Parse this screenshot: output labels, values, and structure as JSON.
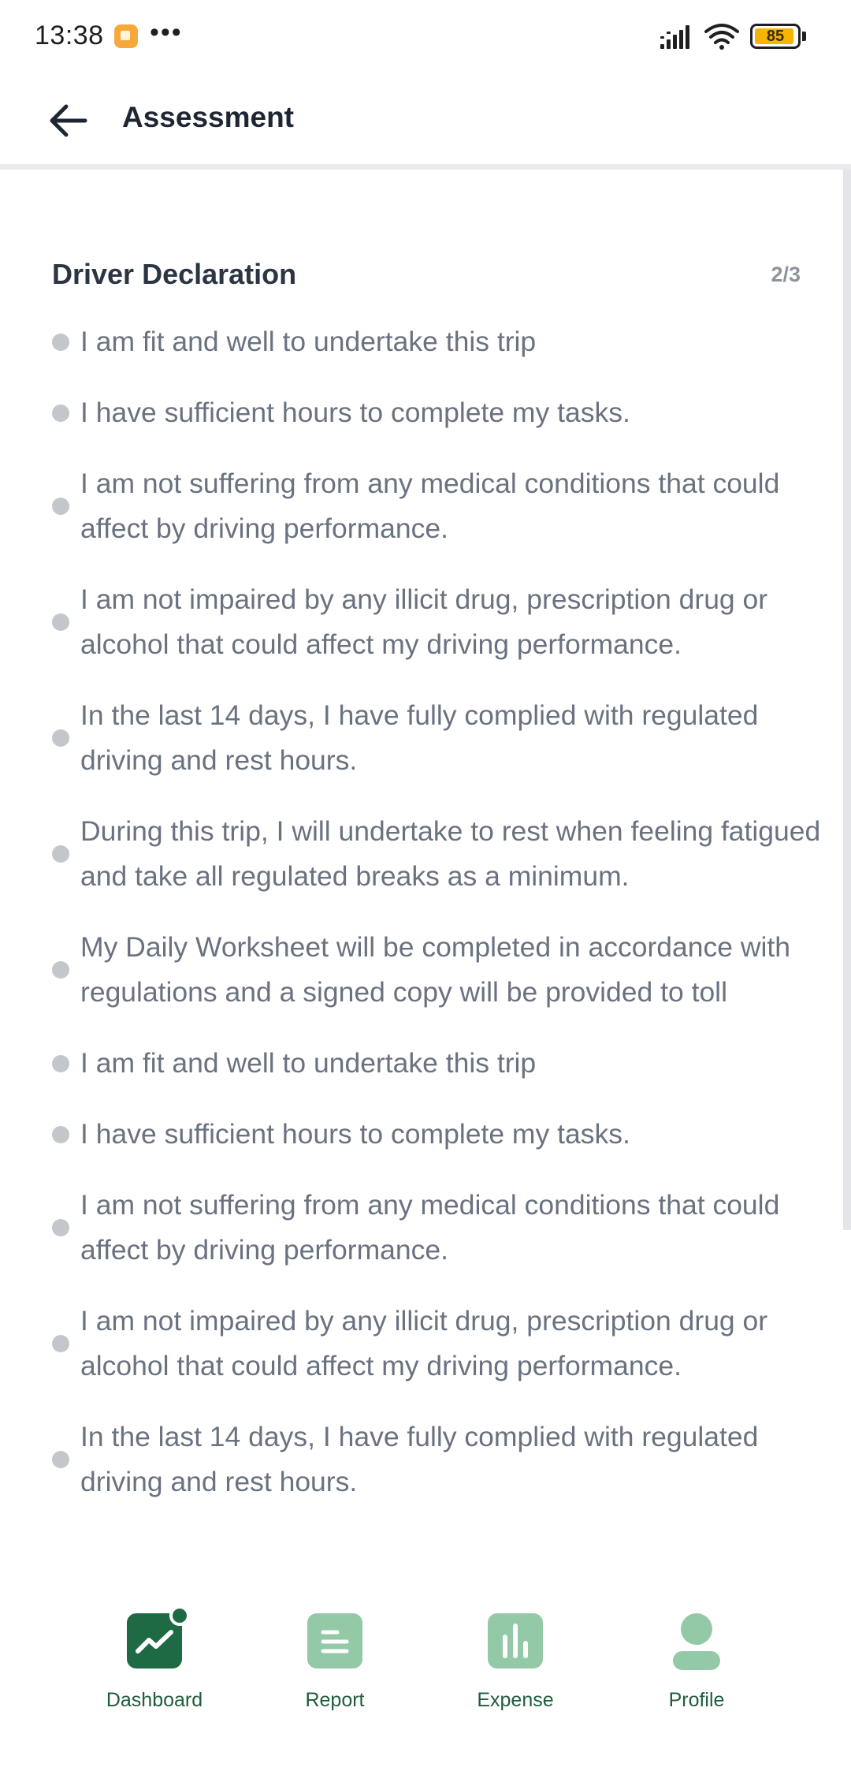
{
  "status_bar": {
    "time": "13:38",
    "more": "•••",
    "battery": "85"
  },
  "header": {
    "title": "Assessment"
  },
  "section": {
    "title": "Driver Declaration",
    "page_indicator": "2/3"
  },
  "declarations": [
    "I am fit and well to undertake this trip",
    "I have sufficient hours to complete my tasks.",
    "I am not suffering from any medical conditions that could affect by driving performance.",
    "I am not impaired by any illicit drug, prescription drug or alcohol that could affect my driving performance.",
    "In the last 14 days, I have fully complied with regulated driving and rest hours.",
    "During this trip, I will undertake to rest when feeling fatigued and take all regulated breaks as a minimum.",
    "My Daily Worksheet will be completed in accordance with regulations and a signed copy will be provided to toll",
    "I am fit and well to undertake this trip",
    "I have sufficient hours to complete my tasks.",
    "I am not suffering from any medical conditions that could affect by driving performance.",
    "I am not impaired by any illicit drug, prescription drug or alcohol that could affect my driving performance.",
    "In the last 14 days, I have fully complied with regulated driving and rest hours."
  ],
  "bottom_nav": {
    "items": [
      {
        "label": "Dashboard",
        "icon": "dashboard-icon",
        "active": true
      },
      {
        "label": "Report",
        "icon": "report-icon",
        "active": false
      },
      {
        "label": "Expense",
        "icon": "expense-icon",
        "active": false
      },
      {
        "label": "Profile",
        "icon": "profile-icon",
        "active": false
      }
    ]
  },
  "colors": {
    "accent_dark": "#1d6a45",
    "accent_light": "#93c9a6",
    "text_title": "#1e2633",
    "text_body": "#6a7280",
    "bullet": "#c3c6cb"
  }
}
